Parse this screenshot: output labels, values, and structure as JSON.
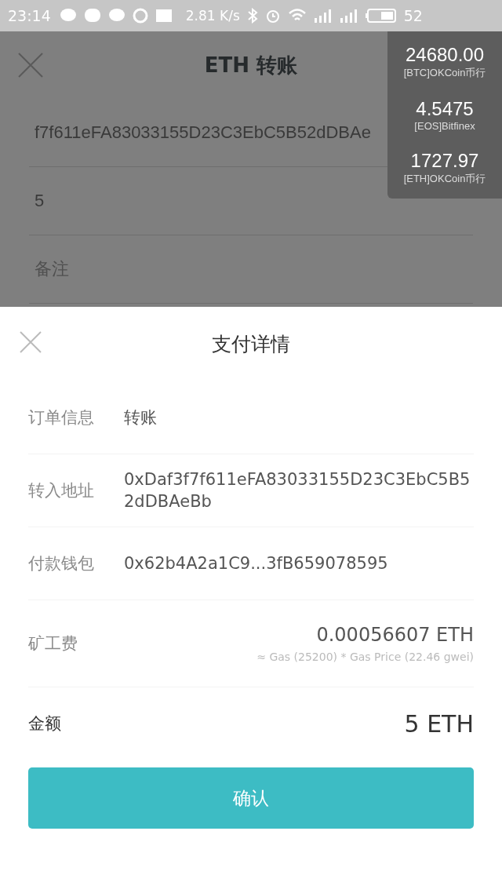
{
  "status_bar": {
    "time": "23:14",
    "speed": "2.81",
    "speed_unit": "K/s",
    "battery": "52"
  },
  "page": {
    "title": "ETH 转账",
    "address": "f7f611eFA83033155D23C3EbC5B52dDBAe",
    "amount": "5",
    "note_placeholder": "备注"
  },
  "ticker": [
    {
      "price": "24680.00",
      "source": "[BTC]OKCoin币行"
    },
    {
      "price": "4.5475",
      "source": "[EOS]Bitfinex"
    },
    {
      "price": "1727.97",
      "source": "[ETH]OKCoin币行"
    }
  ],
  "sheet": {
    "title": "支付详情",
    "rows": [
      {
        "label": "订单信息",
        "value": "转账",
        "kind": "text"
      },
      {
        "label": "转入地址",
        "value": "0xDaf3f7f611eFA83033155D23C3EbC5B52dDBAeBb",
        "kind": "text"
      },
      {
        "label": "付款钱包",
        "value": "0x62b4A2a1C9...3fB659078595",
        "kind": "text"
      },
      {
        "label": "矿工费",
        "value": "0.00056607 ETH",
        "note": "≈ Gas (25200) * Gas Price (22.46 gwei)",
        "kind": "fee"
      },
      {
        "label": "金额",
        "value": "5 ETH",
        "kind": "total"
      }
    ],
    "confirm": "确认"
  }
}
